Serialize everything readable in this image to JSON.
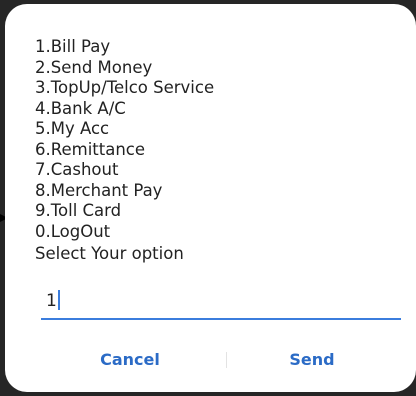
{
  "dialog": {
    "menu_items": [
      "1.Bill Pay",
      "2.Send Money",
      "3.TopUp/Telco Service",
      "4.Bank A/C",
      "5.My Acc",
      "6.Remittance",
      "7.Cashout",
      "8.Merchant Pay",
      "9.Toll Card",
      "0.LogOut"
    ],
    "prompt": "Select Your option",
    "input_value": "1",
    "cancel_label": "Cancel",
    "send_label": "Send"
  },
  "colors": {
    "accent": "#2b6bc6",
    "underline": "#3b7ddd",
    "text": "#222222",
    "backdrop": "#262626"
  },
  "icons": {
    "pointer": "arrow-right-icon"
  }
}
